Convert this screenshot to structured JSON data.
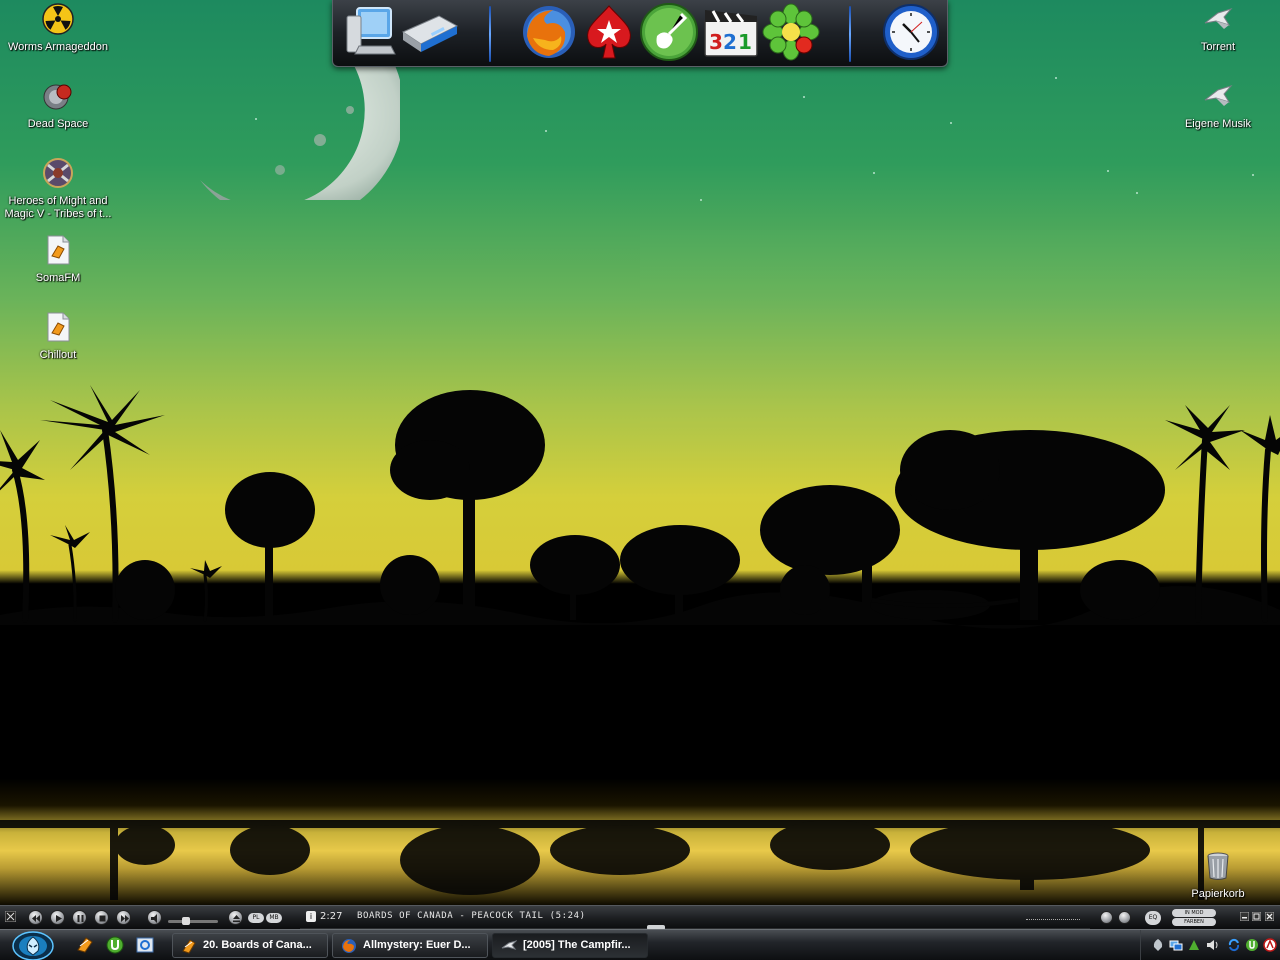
{
  "desktop": {
    "left_icons": [
      {
        "label": "Worms Armageddon",
        "icon": "radiation-icon"
      },
      {
        "label": "Dead Space",
        "icon": "game-orb-icon"
      },
      {
        "label": "Heroes of Might and Magic V - Tribes of t...",
        "icon": "heroes-emblem-icon"
      },
      {
        "label": "SomaFM",
        "icon": "playlist-file-icon"
      },
      {
        "label": "Chillout",
        "icon": "playlist-file-icon"
      }
    ],
    "right_icons": [
      {
        "label": "Torrent",
        "icon": "folder-shortcut-icon"
      },
      {
        "label": "Eigene Musik",
        "icon": "folder-shortcut-icon"
      }
    ],
    "recycle_bin": {
      "label": "Papierkorb",
      "icon": "recycle-bin-icon"
    }
  },
  "dock": {
    "items": [
      "my-computer-icon",
      "drive-icon",
      "firefox-icon",
      "pokerstars-icon",
      "guitar-icon",
      "media-player-classic-icon",
      "icq-flower-icon",
      "clock-icon"
    ]
  },
  "media_bar": {
    "elapsed": "2:27",
    "now_playing": "BOARDS OF CANADA - PEACOCK TAIL (5:24)",
    "progress": 0.45,
    "pill_pl": "PL",
    "pill_mb": "MB",
    "pill_eq": "EQ",
    "mode_top": "IN MOD",
    "mode_bottom": "FARBEN"
  },
  "taskbar": {
    "buttons": [
      {
        "label": "20. Boards of Cana...",
        "icon": "winamp-icon",
        "active": false
      },
      {
        "label": "Allmystery: Euer D...",
        "icon": "firefox-icon",
        "active": false
      },
      {
        "label": "[2005] The Campfir...",
        "icon": "folder-shortcut-icon",
        "active": true
      }
    ]
  },
  "colors": {
    "sky_top": "#1d8a5f",
    "sky_horizon": "#d5cf3b",
    "dock_separator": "#6aa8ff"
  }
}
